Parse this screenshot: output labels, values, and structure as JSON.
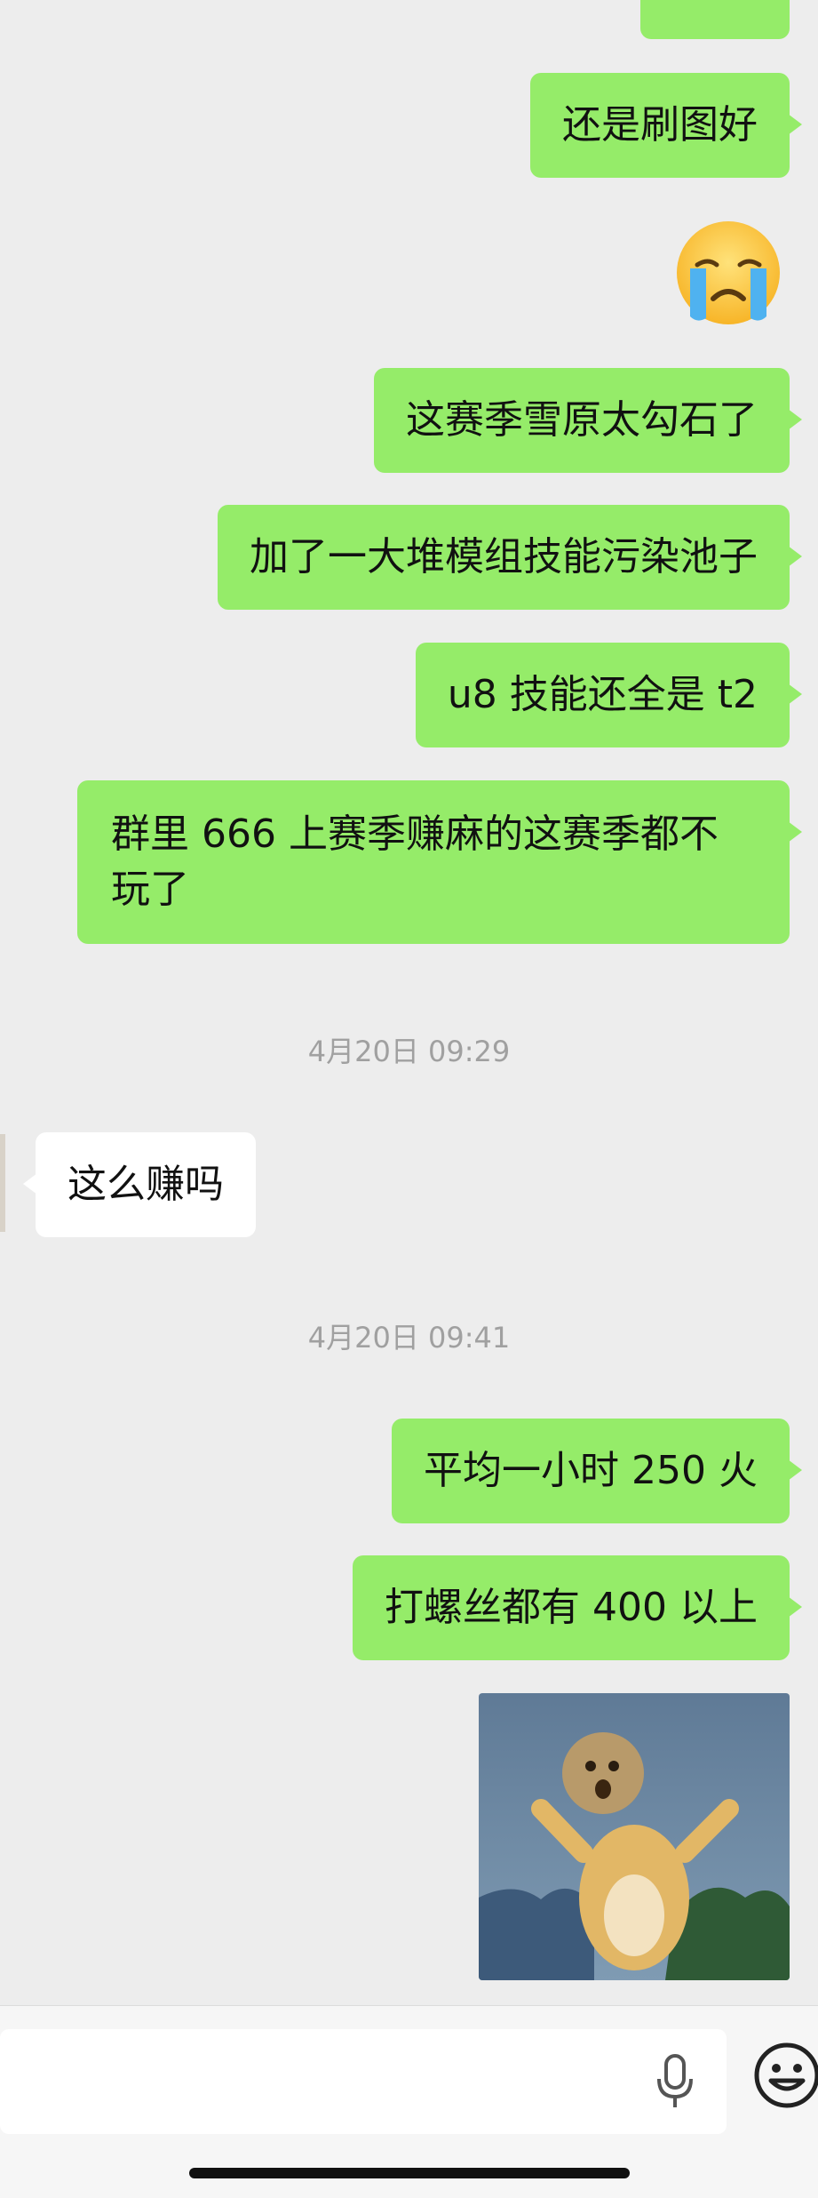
{
  "messages": [
    {
      "text": "还是刷图好"
    },
    {
      "text": "这赛季雪原太勾石了"
    },
    {
      "text": "加了一大堆模组技能污染池子"
    },
    {
      "text": "u8 技能还全是 t2"
    },
    {
      "text": "群里 666 上赛季赚麻的这赛季都不玩了"
    },
    {
      "text": "这么赚吗"
    },
    {
      "text": "平均一小时 250 火"
    },
    {
      "text": "打螺丝都有 400 以上"
    }
  ],
  "timestamps": [
    "4月20日 09:29",
    "4月20日 09:41"
  ],
  "colors": {
    "outgoing_bubble": "#95ec69",
    "incoming_bubble": "#ffffff",
    "background": "#ededed"
  },
  "icons": {
    "emoji_sticker": "crying-face-icon",
    "voice": "microphone-icon",
    "emoji_panel": "smiley-icon"
  }
}
